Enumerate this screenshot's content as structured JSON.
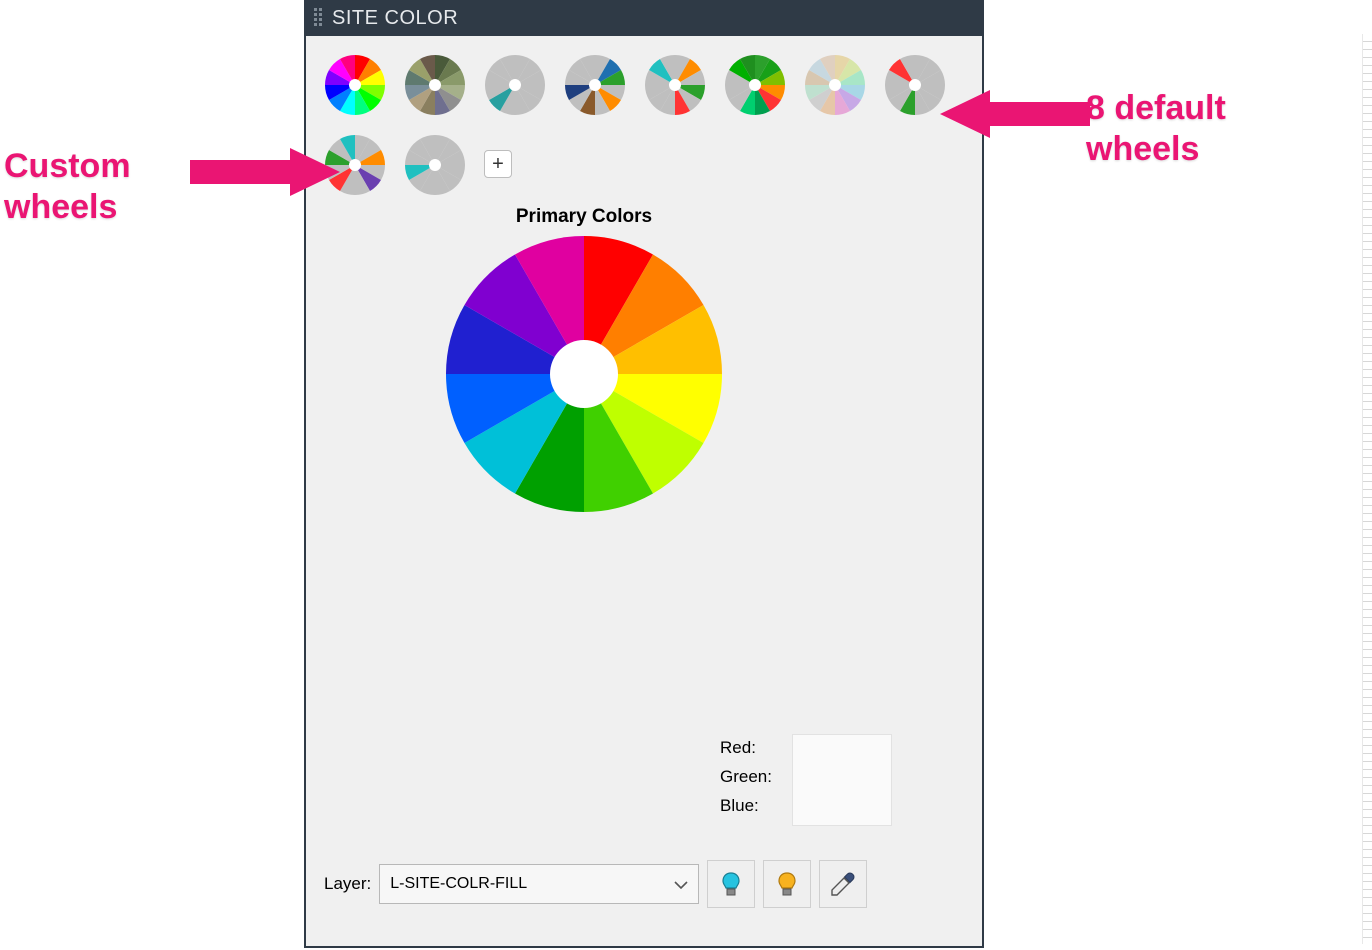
{
  "panel": {
    "title": "SITE COLOR"
  },
  "annotations": {
    "custom_wheels_label": "Custom\nwheels",
    "default_wheels_label": "8 default\nwheels"
  },
  "preset_wheels": [
    {
      "name": "primary-colors",
      "colors": [
        "#ff0000",
        "#ff7f00",
        "#ffff00",
        "#7fff00",
        "#00ff00",
        "#00ff7f",
        "#00ffff",
        "#007fff",
        "#0000ff",
        "#7f00ff",
        "#ff00ff",
        "#ff007f"
      ]
    },
    {
      "name": "muted-olive",
      "colors": [
        "#4a5a3a",
        "#6a7a4f",
        "#8a9a6a",
        "#a5b08a",
        "#8f8f8f",
        "#6f6f8f",
        "#8a7f5f",
        "#b0a080",
        "#7a8f9a",
        "#5f7a6f",
        "#9aa06a",
        "#6a5a4a"
      ]
    },
    {
      "name": "gray-teal",
      "colors": [
        "#bfbfbf",
        "#bfbfbf",
        "#bfbfbf",
        "#bfbfbf",
        "#bfbfbf",
        "#bfbfbf",
        "#bfbfbf",
        "#28a0a0",
        "#bfbfbf",
        "#bfbfbf",
        "#bfbfbf",
        "#bfbfbf"
      ]
    },
    {
      "name": "gray-mixed-1",
      "colors": [
        "#bfbfbf",
        "#1f6fb0",
        "#2ca02c",
        "#bfbfbf",
        "#ff8c00",
        "#bfbfbf",
        "#8a5a2b",
        "#bfbfbf",
        "#1f3f7f",
        "#bfbfbf",
        "#bfbfbf",
        "#bfbfbf"
      ]
    },
    {
      "name": "gray-mixed-2",
      "colors": [
        "#bfbfbf",
        "#ff8c00",
        "#bfbfbf",
        "#2ca02c",
        "#bfbfbf",
        "#ff3333",
        "#bfbfbf",
        "#bfbfbf",
        "#bfbfbf",
        "#bfbfbf",
        "#20c0c0",
        "#bfbfbf"
      ]
    },
    {
      "name": "green-multi",
      "colors": [
        "#2ca02c",
        "#18a018",
        "#7fbf00",
        "#ff8c00",
        "#ff3333",
        "#009f4f",
        "#00cf6f",
        "#bfbfbf",
        "#bfbfbf",
        "#bfbfbf",
        "#00b000",
        "#1f8f1f"
      ]
    },
    {
      "name": "pastel",
      "colors": [
        "#e6d6a8",
        "#d7e6a8",
        "#a8e6c7",
        "#a8d7e6",
        "#c7a8e6",
        "#e6a8d7",
        "#e6c7a8",
        "#cfcfcf",
        "#bfe0cf",
        "#d8c7b0",
        "#c7d8e0",
        "#e0d0c0"
      ]
    },
    {
      "name": "gray-rg",
      "colors": [
        "#bfbfbf",
        "#bfbfbf",
        "#bfbfbf",
        "#bfbfbf",
        "#bfbfbf",
        "#bfbfbf",
        "#2ca02c",
        "#bfbfbf",
        "#bfbfbf",
        "#bfbfbf",
        "#ff3333",
        "#bfbfbf"
      ]
    }
  ],
  "custom_wheels": [
    {
      "name": "custom-1",
      "colors": [
        "#bfbfbf",
        "#bfbfbf",
        "#ff8c00",
        "#bfbfbf",
        "#6a3fb0",
        "#bfbfbf",
        "#bfbfbf",
        "#ff3333",
        "#bfbfbf",
        "#2ca02c",
        "#bfbfbf",
        "#20c0c0"
      ]
    },
    {
      "name": "custom-2",
      "colors": [
        "#bfbfbf",
        "#bfbfbf",
        "#bfbfbf",
        "#bfbfbf",
        "#bfbfbf",
        "#bfbfbf",
        "#bfbfbf",
        "#bfbfbf",
        "#20c0c0",
        "#bfbfbf",
        "#bfbfbf",
        "#bfbfbf"
      ]
    }
  ],
  "add_button_label": "+",
  "main_wheel": {
    "title": "Primary Colors",
    "colors": [
      "#ff0000",
      "#ff7f00",
      "#ffbf00",
      "#ffff00",
      "#bfff00",
      "#40d000",
      "#00a000",
      "#00c0d8",
      "#0060ff",
      "#2020d0",
      "#8000d0",
      "#e000a0"
    ]
  },
  "rgb": {
    "red_label": "Red:",
    "green_label": "Green:",
    "blue_label": "Blue:"
  },
  "layer": {
    "label": "Layer:",
    "selected": "L-SITE-COLR-FILL"
  },
  "tools": {
    "bulb_blue": "cyan-bulb-icon",
    "bulb_orange": "orange-bulb-icon",
    "eyedropper": "eyedropper-icon"
  }
}
